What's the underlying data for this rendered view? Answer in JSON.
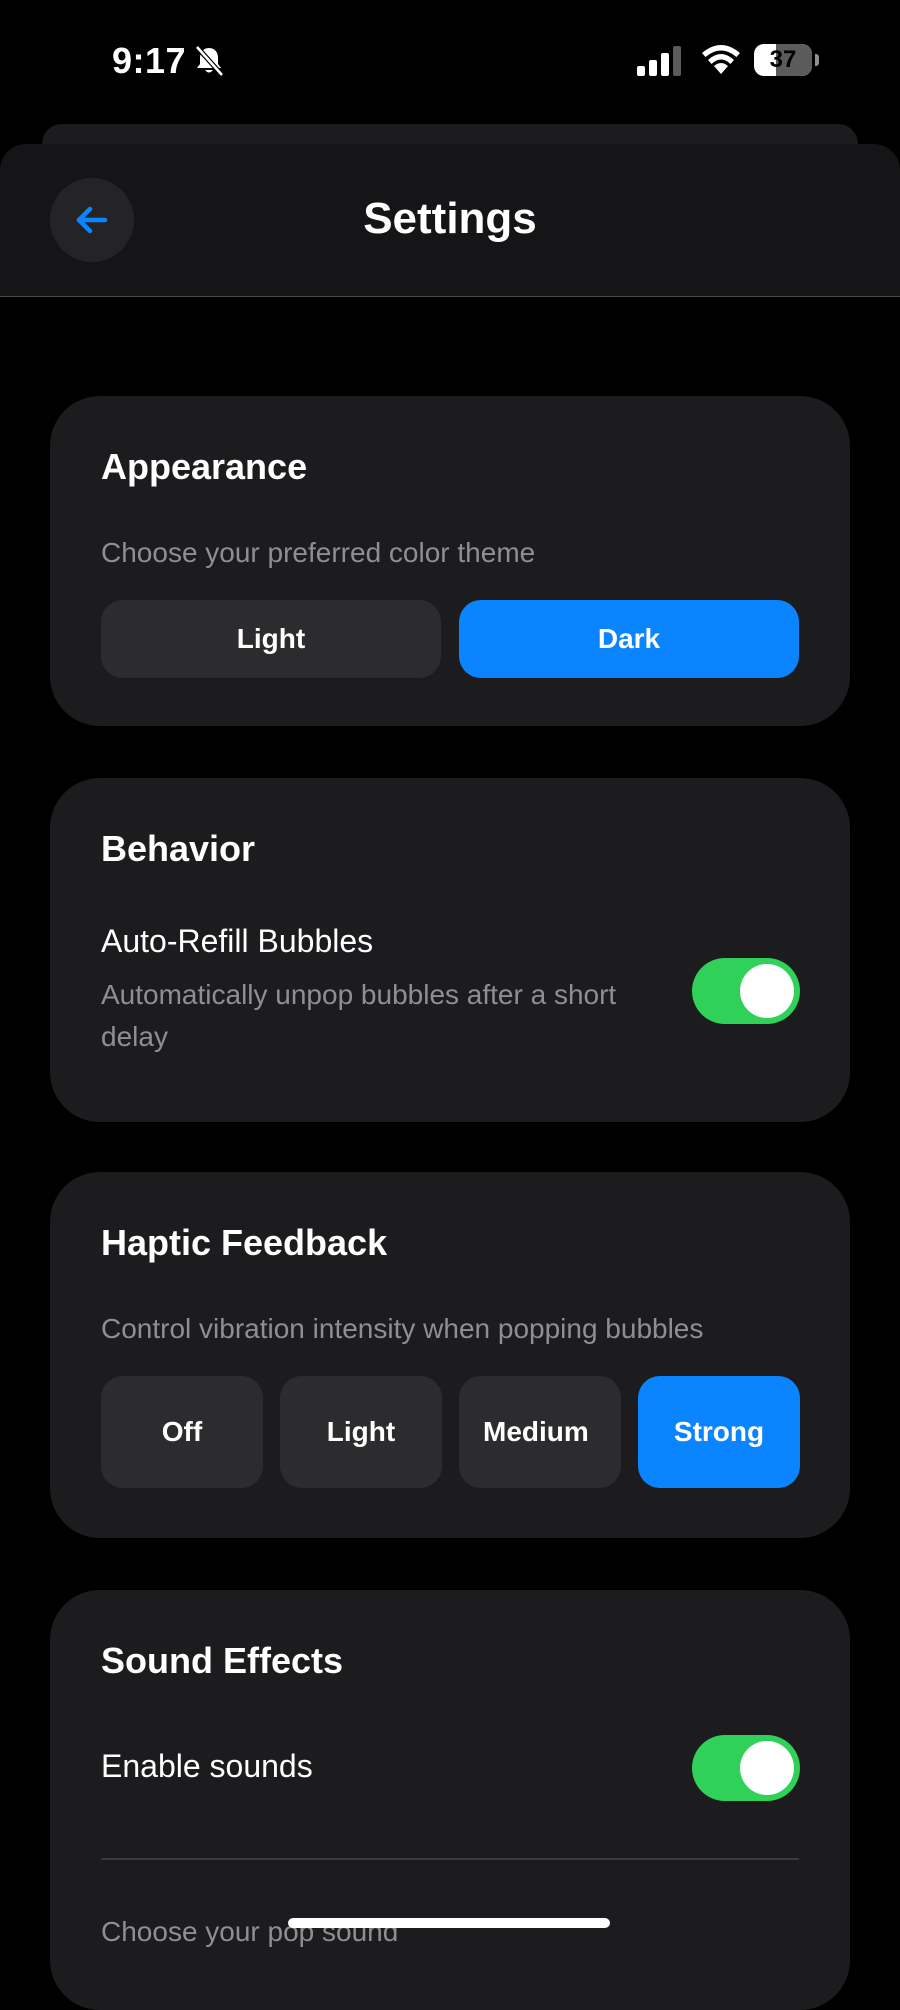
{
  "status_bar": {
    "time": "9:17",
    "battery": "37",
    "icons": [
      "bell-slash-icon",
      "signal-icon",
      "wifi-icon",
      "battery-icon"
    ]
  },
  "header": {
    "title": "Settings",
    "back_icon": "arrow-left-icon"
  },
  "colors": {
    "background": "#000000",
    "card": "#1c1c1e",
    "accent": "#0a84ff",
    "toggle_on": "#30d158",
    "secondary_text": "#8e8e93",
    "segment": "#2c2c2e"
  },
  "appearance": {
    "title": "Appearance",
    "description": "Choose your preferred color theme",
    "options": [
      "Light",
      "Dark"
    ],
    "selected": "Dark"
  },
  "behavior": {
    "title": "Behavior",
    "auto_refill_label": "Auto-Refill Bubbles",
    "auto_refill_description": "Automatically unpop bubbles after a short delay",
    "auto_refill_on": true
  },
  "haptic": {
    "title": "Haptic Feedback",
    "description": "Control vibration intensity when popping bubbles",
    "options": [
      "Off",
      "Light",
      "Medium",
      "Strong"
    ],
    "selected": "Strong"
  },
  "sound": {
    "title": "Sound Effects",
    "enable_label": "Enable sounds",
    "enable_on": true,
    "pop_sound_label": "Choose your pop sound"
  }
}
